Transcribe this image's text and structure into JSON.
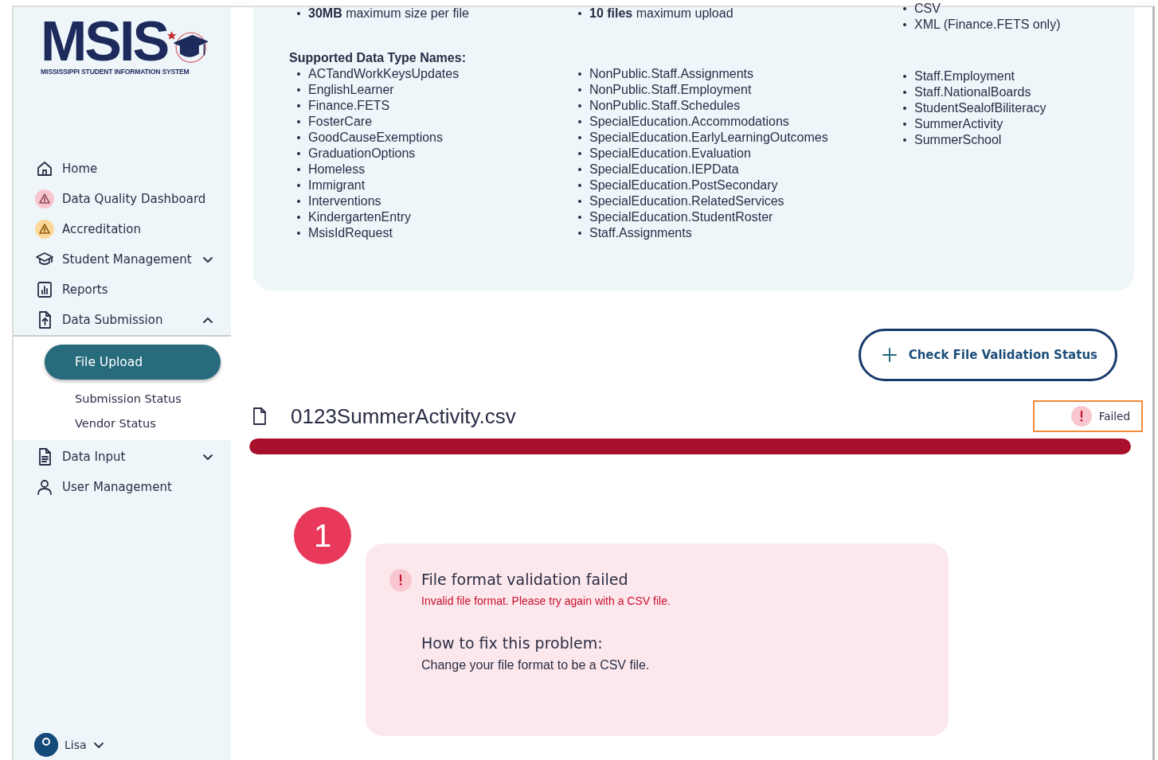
{
  "logo": {
    "title": "MSIS",
    "subtitle": "MISSISSIPPI STUDENT INFORMATION SYSTEM"
  },
  "nav": [
    {
      "label": "Home"
    },
    {
      "label": "Data Quality Dashboard",
      "color": "#f9c6d0"
    },
    {
      "label": "Accreditation",
      "color": "#fcd79a"
    },
    {
      "label": "Student Management",
      "expanded": false
    },
    {
      "label": "Reports"
    },
    {
      "label": "Data Submission",
      "expanded": true,
      "children": [
        {
          "label": "File Upload",
          "selected": true
        },
        {
          "label": "Submission Status",
          "selected": false
        },
        {
          "label": "Vendor Status",
          "selected": false
        }
      ]
    },
    {
      "label": "Data Input",
      "expanded": false
    },
    {
      "label": "User Management"
    }
  ],
  "user": {
    "name": "Lisa"
  },
  "info": {
    "limits": [
      "**30MB** maximum size per file",
      "**10 files** maximum upload"
    ],
    "formats": [
      "CSV",
      "XML (Finance.FETS only)"
    ],
    "types_heading": "Supported Data Type Names:",
    "type_columns": [
      [
        "ACTandWorkKeysUpdates",
        "EnglishLearner",
        "Finance.FETS",
        "FosterCare",
        "GoodCauseExemptions",
        "GraduationOptions",
        "Homeless",
        "Immigrant",
        "Interventions",
        "KindergartenEntry",
        "MsisIdRequest"
      ],
      [
        "NonPublic.Staff.Assignments",
        "NonPublic.Staff.Employment",
        "NonPublic.Staff.Schedules",
        "SpecialEducation.Accommodations",
        "SpecialEducation.EarlyLearningOutcomes",
        "SpecialEducation.Evaluation",
        "SpecialEducation.IEPData",
        "SpecialEducation.PostSecondary",
        "SpecialEducation.RelatedServices",
        "SpecialEducation.StudentRoster",
        "Staff.Assignments"
      ],
      [
        "Staff.Employment",
        "Staff.NationalBoards",
        "StudentSealofBiliteracy",
        "SummerActivity",
        "SummerSchool"
      ]
    ]
  },
  "check_button": "Check File Validation Status",
  "file": {
    "name": "0123SummerActivity.csv",
    "status": "Failed",
    "highlighted": true,
    "level": 1
  },
  "step": "1",
  "error": {
    "title": "File format validation failed",
    "message": "Invalid file format. Please try again with a CSV file.",
    "fix_heading": "How to fix this problem:",
    "fix_text": "Change your file format to be a CSV file."
  }
}
